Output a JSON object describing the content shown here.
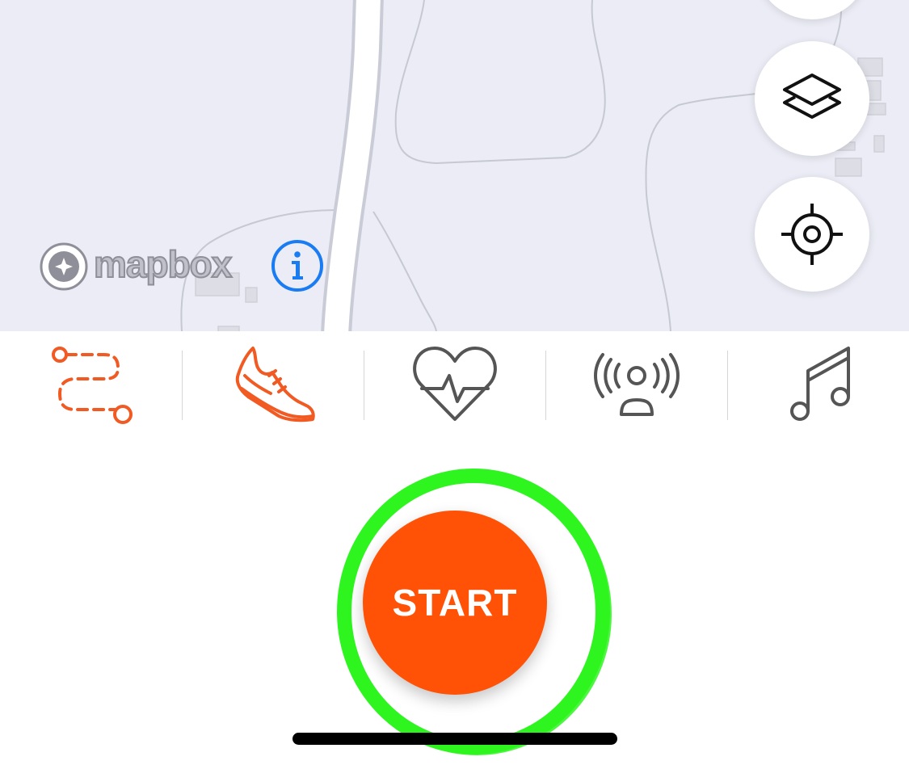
{
  "map": {
    "attribution_logo_text": "mapbox",
    "info_icon": "info-circle-icon",
    "controls": [
      {
        "name": "map-control-top",
        "icon": "partial-hidden-icon"
      },
      {
        "name": "layers",
        "icon": "layers-icon"
      },
      {
        "name": "locate",
        "icon": "crosshair-icon"
      }
    ],
    "colors": {
      "background": "#ebecf5",
      "road": "#ffffff",
      "road_outline": "#c9cbd6",
      "path": "#c6c8d2",
      "info": "#1a7cf2"
    }
  },
  "toolbar": {
    "items": [
      {
        "name": "route",
        "icon": "route-icon",
        "active": true
      },
      {
        "name": "shoe",
        "icon": "running-shoe-icon",
        "active": true
      },
      {
        "name": "heart-rate",
        "icon": "heart-rate-icon",
        "active": false
      },
      {
        "name": "voice-coach",
        "icon": "voice-broadcast-icon",
        "active": false
      },
      {
        "name": "music",
        "icon": "music-note-icon",
        "active": false
      }
    ],
    "colors": {
      "active": "#f15a22",
      "inactive": "#555555"
    }
  },
  "start": {
    "label": "START",
    "color": "#ff5207",
    "ring_color": "#2ef51f"
  }
}
